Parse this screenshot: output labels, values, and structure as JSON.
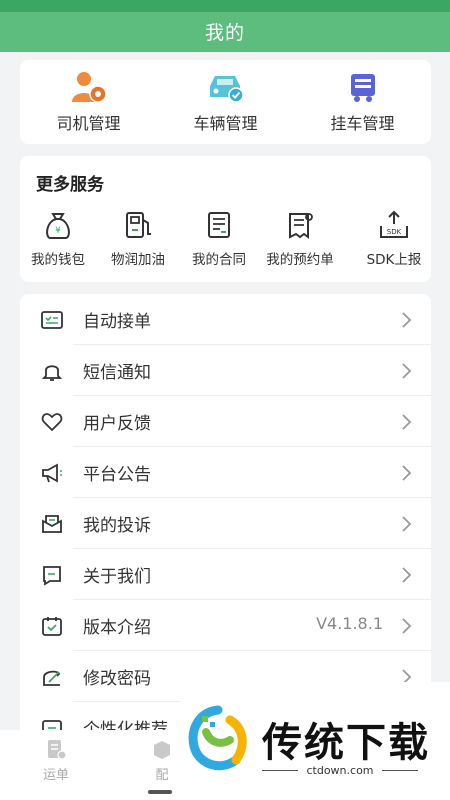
{
  "header": {
    "title": "我的"
  },
  "management": [
    {
      "label": "司机管理",
      "icon": "driver-icon"
    },
    {
      "label": "车辆管理",
      "icon": "vehicle-icon"
    },
    {
      "label": "挂车管理",
      "icon": "trailer-icon"
    }
  ],
  "more_services": {
    "title": "更多服务",
    "items": [
      {
        "label": "我的钱包",
        "icon": "wallet-icon"
      },
      {
        "label": "物润加油",
        "icon": "fuel-icon"
      },
      {
        "label": "我的合同",
        "icon": "contract-icon"
      },
      {
        "label": "我的预约单",
        "icon": "booking-icon"
      },
      {
        "label": "SDK上报",
        "icon": "sdk-upload-icon"
      }
    ]
  },
  "menu": [
    {
      "label": "自动接单",
      "icon": "auto-order-icon"
    },
    {
      "label": "短信通知",
      "icon": "bell-icon"
    },
    {
      "label": "用户反馈",
      "icon": "heart-icon"
    },
    {
      "label": "平台公告",
      "icon": "megaphone-icon"
    },
    {
      "label": "我的投诉",
      "icon": "complaint-mail-icon"
    },
    {
      "label": "关于我们",
      "icon": "about-icon"
    },
    {
      "label": "版本介绍",
      "icon": "calendar-check-icon",
      "value": "V4.1.8.1"
    },
    {
      "label": "修改密码",
      "icon": "edit-password-icon"
    },
    {
      "label": "个性化推荐",
      "icon": "personalize-icon"
    }
  ],
  "tabbar": [
    {
      "label": "运单",
      "icon": "waybill-icon"
    },
    {
      "label": "配",
      "icon": "dispatch-icon"
    }
  ],
  "watermark": {
    "brand": "传统下载",
    "site": "ctdown.com"
  },
  "colors": {
    "header": "#5cbd7e",
    "status_bar": "#3aa862",
    "accent_orange": "#f08a3c",
    "accent_teal": "#56c4d8",
    "accent_purple": "#5b63d8",
    "icon_dark": "#333333"
  }
}
